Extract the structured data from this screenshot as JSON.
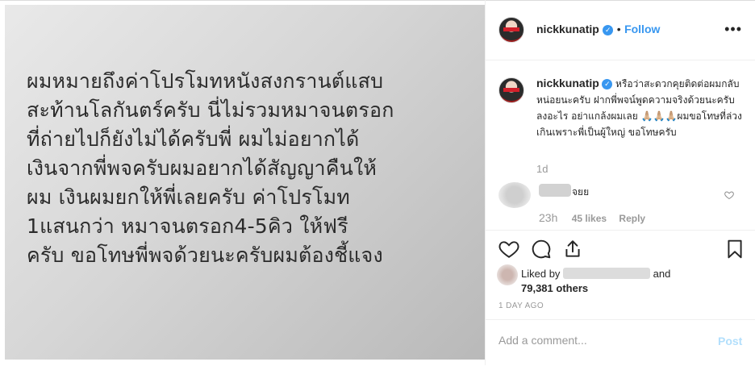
{
  "post": {
    "image_text": "ผมหมายถึงค่าโปรโมทหนังสงกรานต์แสบ\nสะท้านโลกันตร์ครับ  นี่ไม่รวมหมาจนตรอก\nที่ถ่ายไปก็ยังไม่ได้ครับพี่  ผมไม่อยากได้\nเงินจากพี่พจครับผมอยากได้สัญญาคืนให้\nผม  เงินผมยกให้พี่เลยครับ  ค่าโปรโมท\n1แสนกว่า  หมาจนตรอก4-5คิว  ให้ฟรี\nครับ  ขอโทษพี่พจด้วยนะครับผมต้องชี้แจง"
  },
  "header": {
    "username": "nickkunatip",
    "verified_icon": "✓",
    "separator": "•",
    "follow_label": "Follow",
    "more_icon": "•••"
  },
  "caption": {
    "username": "nickkunatip",
    "text": "หรือว่าสะดวกคุยติดต่อผมกลับหน่อยนะครับ ฝากพี่พจน์พูดความจริงด้วยนะครับ ลงอะไร อย่าแกล้งผมเลย 🙏🏼🙏🏼🙏🏼ผมขอโทษที่ล่วงเกินเพราะพี่เป็นผู้ใหญ่ ขอโทษครับ",
    "time": "1d"
  },
  "comment": {
    "text": "จยย",
    "time": "23h",
    "likes": "45 likes",
    "reply_label": "Reply"
  },
  "likes": {
    "liked_by_label": "Liked by",
    "and_label": "and",
    "others": "79,381 others"
  },
  "timestamp": "1 DAY AGO",
  "add_comment": {
    "placeholder": "Add a comment...",
    "post_label": "Post"
  },
  "colors": {
    "accent": "#3897f0",
    "post_disabled": "#b2dffc",
    "muted": "#999999"
  }
}
